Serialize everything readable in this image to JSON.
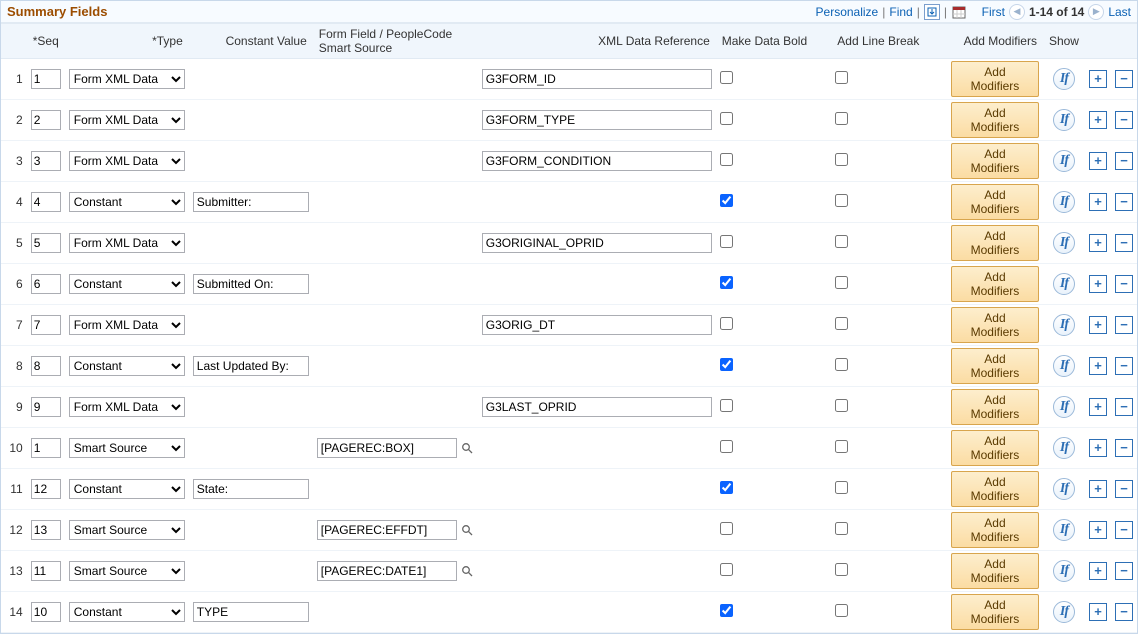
{
  "grid": {
    "title": "Summary Fields",
    "nav": {
      "personalize": "Personalize",
      "find": "Find",
      "first": "First",
      "range": "1-14 of 14",
      "last": "Last"
    },
    "columns": {
      "seq": "*Seq",
      "type": "*Type",
      "const": "Constant Value",
      "smart": "Form Field / PeopleCode Smart Source",
      "xml": "XML Data Reference",
      "bold": "Make Data Bold",
      "linebreak": "Add Line Break",
      "modifiers": "Add Modifiers",
      "show": "Show"
    },
    "addModifiersLabel": "Add Modifiers",
    "typeOptions": [
      "Form XML Data",
      "Constant",
      "Smart Source"
    ],
    "rows": [
      {
        "row": "1",
        "seq": "1",
        "type": "Form XML Data",
        "const": "",
        "smart": "",
        "xml": "G3FORM_ID",
        "bold": false,
        "br": false,
        "showConst": false,
        "showSmart": false,
        "showXml": true
      },
      {
        "row": "2",
        "seq": "2",
        "type": "Form XML Data",
        "const": "",
        "smart": "",
        "xml": "G3FORM_TYPE",
        "bold": false,
        "br": false,
        "showConst": false,
        "showSmart": false,
        "showXml": true
      },
      {
        "row": "3",
        "seq": "3",
        "type": "Form XML Data",
        "const": "",
        "smart": "",
        "xml": "G3FORM_CONDITION",
        "bold": false,
        "br": false,
        "showConst": false,
        "showSmart": false,
        "showXml": true
      },
      {
        "row": "4",
        "seq": "4",
        "type": "Constant",
        "const": "Submitter:",
        "smart": "",
        "xml": "",
        "bold": true,
        "br": false,
        "showConst": true,
        "showSmart": false,
        "showXml": false
      },
      {
        "row": "5",
        "seq": "5",
        "type": "Form XML Data",
        "const": "",
        "smart": "",
        "xml": "G3ORIGINAL_OPRID",
        "bold": false,
        "br": false,
        "showConst": false,
        "showSmart": false,
        "showXml": true
      },
      {
        "row": "6",
        "seq": "6",
        "type": "Constant",
        "const": "Submitted On:",
        "smart": "",
        "xml": "",
        "bold": true,
        "br": false,
        "showConst": true,
        "showSmart": false,
        "showXml": false
      },
      {
        "row": "7",
        "seq": "7",
        "type": "Form XML Data",
        "const": "",
        "smart": "",
        "xml": "G3ORIG_DT",
        "bold": false,
        "br": false,
        "showConst": false,
        "showSmart": false,
        "showXml": true
      },
      {
        "row": "8",
        "seq": "8",
        "type": "Constant",
        "const": "Last Updated By:",
        "smart": "",
        "xml": "",
        "bold": true,
        "br": false,
        "showConst": true,
        "showSmart": false,
        "showXml": false
      },
      {
        "row": "9",
        "seq": "9",
        "type": "Form XML Data",
        "const": "",
        "smart": "",
        "xml": "G3LAST_OPRID",
        "bold": false,
        "br": false,
        "showConst": false,
        "showSmart": false,
        "showXml": true
      },
      {
        "row": "10",
        "seq": "1",
        "type": "Smart Source",
        "const": "",
        "smart": "[PAGEREC:BOX]",
        "xml": "",
        "bold": false,
        "br": false,
        "showConst": false,
        "showSmart": true,
        "showXml": false
      },
      {
        "row": "11",
        "seq": "12",
        "type": "Constant",
        "const": "State:",
        "smart": "",
        "xml": "",
        "bold": true,
        "br": false,
        "showConst": true,
        "showSmart": false,
        "showXml": false
      },
      {
        "row": "12",
        "seq": "13",
        "type": "Smart Source",
        "const": "",
        "smart": "[PAGEREC:EFFDT]",
        "xml": "",
        "bold": false,
        "br": false,
        "showConst": false,
        "showSmart": true,
        "showXml": false
      },
      {
        "row": "13",
        "seq": "11",
        "type": "Smart Source",
        "const": "",
        "smart": "[PAGEREC:DATE1]",
        "xml": "",
        "bold": false,
        "br": false,
        "showConst": false,
        "showSmart": true,
        "showXml": false
      },
      {
        "row": "14",
        "seq": "10",
        "type": "Constant",
        "const": "TYPE",
        "smart": "",
        "xml": "",
        "bold": true,
        "br": false,
        "showConst": true,
        "showSmart": false,
        "showXml": false
      }
    ]
  }
}
